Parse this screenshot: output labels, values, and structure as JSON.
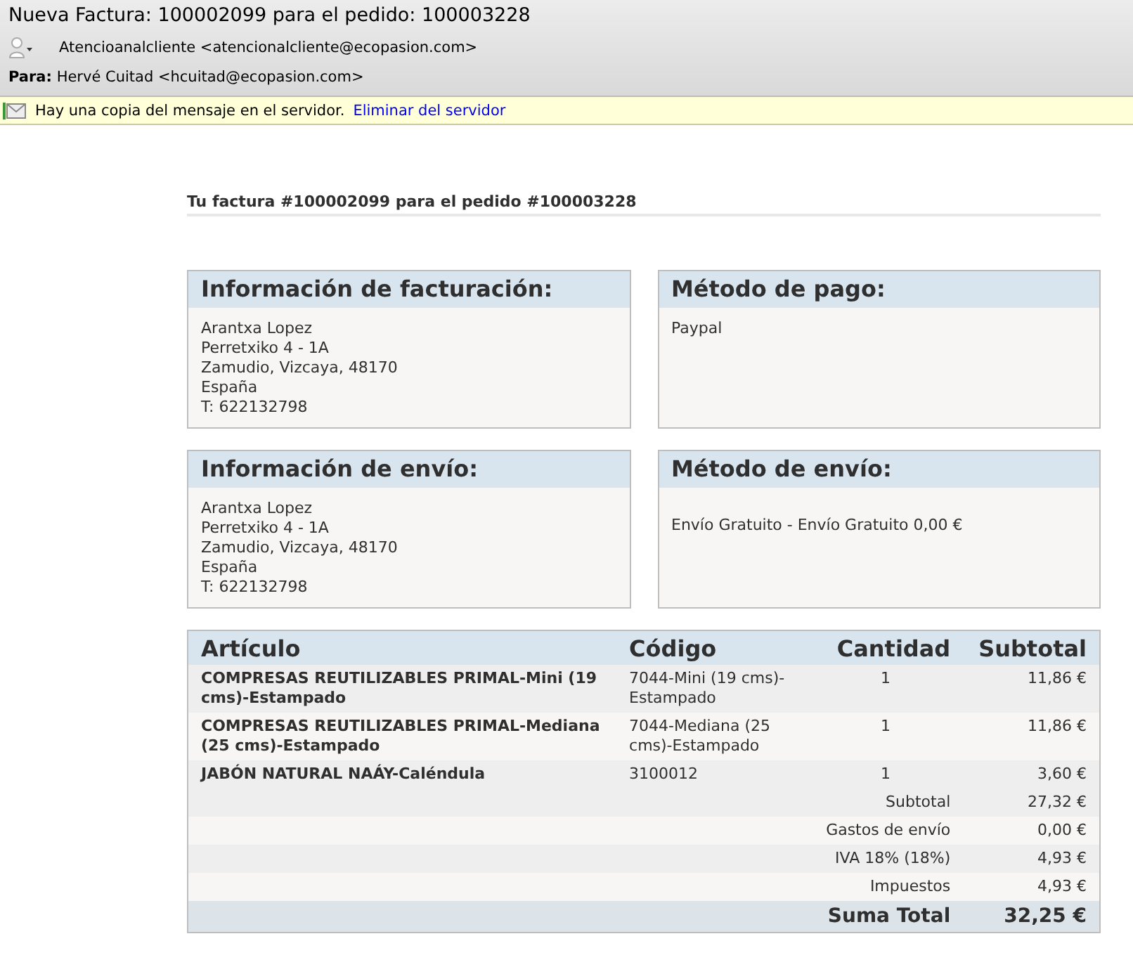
{
  "header": {
    "subject": "Nueva Factura:  100002099 para el pedido: 100003228",
    "from": "Atencioanalcliente <atencionalcliente@ecopasion.com>",
    "to_label": "Para:",
    "to": "Hervé Cuitad <hcuitad@ecopasion.com>"
  },
  "notice": {
    "text": "Hay una copia del mensaje en el servidor.",
    "link": "Eliminar del servidor"
  },
  "invoice_title": "Tu factura #100002099 para el pedido #100003228",
  "boxes": [
    {
      "title": "Información de facturación:",
      "lines": [
        "Arantxa Lopez",
        "Perretxiko 4 - 1A",
        "Zamudio, Vizcaya, 48170",
        "España",
        "T: 622132798"
      ],
      "offset": false
    },
    {
      "title": "Método de pago:",
      "lines": [
        "Paypal"
      ],
      "offset": false
    },
    {
      "title": "Información de envío:",
      "lines": [
        "Arantxa Lopez",
        "Perretxiko 4 - 1A",
        "Zamudio, Vizcaya, 48170",
        "España",
        "T: 622132798"
      ],
      "offset": false
    },
    {
      "title": "Método de envío:",
      "lines": [
        "Envío Gratuito - Envío Gratuito 0,00 €"
      ],
      "offset": true
    }
  ],
  "table": {
    "columns": [
      "Artículo",
      "Código",
      "Cantidad",
      "Subtotal"
    ],
    "rows": [
      {
        "item": "COMPRESAS REUTILIZABLES PRIMAL-Mini (19 cms)-Estampado",
        "code": "7044-Mini (19 cms)-Estampado",
        "qty": "1",
        "subtotal": "11,86 €"
      },
      {
        "item": "COMPRESAS REUTILIZABLES PRIMAL-Mediana (25 cms)-Estampado",
        "code": "7044-Mediana (25 cms)-Estampado",
        "qty": "1",
        "subtotal": "11,86 €"
      },
      {
        "item": "JABÓN NATURAL NAÁY-Caléndula",
        "code": "3100012",
        "qty": "1",
        "subtotal": "3,60 €"
      }
    ],
    "totals": [
      {
        "label": "Subtotal",
        "value": "27,32 €"
      },
      {
        "label": "Gastos de envío",
        "value": "0,00 €"
      },
      {
        "label": "IVA 18% (18%)",
        "value": "4,93 €"
      },
      {
        "label": "Impuestos",
        "value": "4,93 €"
      }
    ],
    "grand_total": {
      "label": "Suma Total",
      "value": "32,25 €"
    }
  }
}
